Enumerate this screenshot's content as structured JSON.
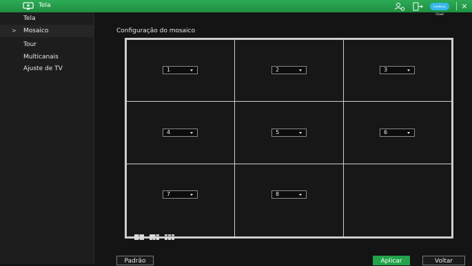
{
  "window": {
    "title": "Tela",
    "cloud_label": "Intelbras Cloud",
    "accent_color": "#22a34b",
    "icons": [
      "monitor-icon",
      "user-settings-icon",
      "logout-icon",
      "cloud-icon",
      "close-icon"
    ]
  },
  "sidebar": {
    "items": [
      {
        "label": "Tela",
        "active": false
      },
      {
        "label": "Mosaico",
        "active": true
      },
      {
        "label": "Tour",
        "active": false
      },
      {
        "label": "Multicanais",
        "active": false
      },
      {
        "label": "Ajuste de TV",
        "active": false
      }
    ],
    "active_marker": ">"
  },
  "main": {
    "section_title": "Configuração do mosaico",
    "cells": [
      {
        "value": "1"
      },
      {
        "value": "2"
      },
      {
        "value": "3"
      },
      {
        "value": "4"
      },
      {
        "value": "5"
      },
      {
        "value": "6"
      },
      {
        "value": "7"
      },
      {
        "value": "8"
      },
      {
        "value": ""
      }
    ],
    "layout_options": [
      "split-4-icon",
      "split-6-icon",
      "split-9-icon"
    ]
  },
  "footer": {
    "default_label": "Padrão",
    "apply_label": "Aplicar",
    "back_label": "Voltar"
  }
}
